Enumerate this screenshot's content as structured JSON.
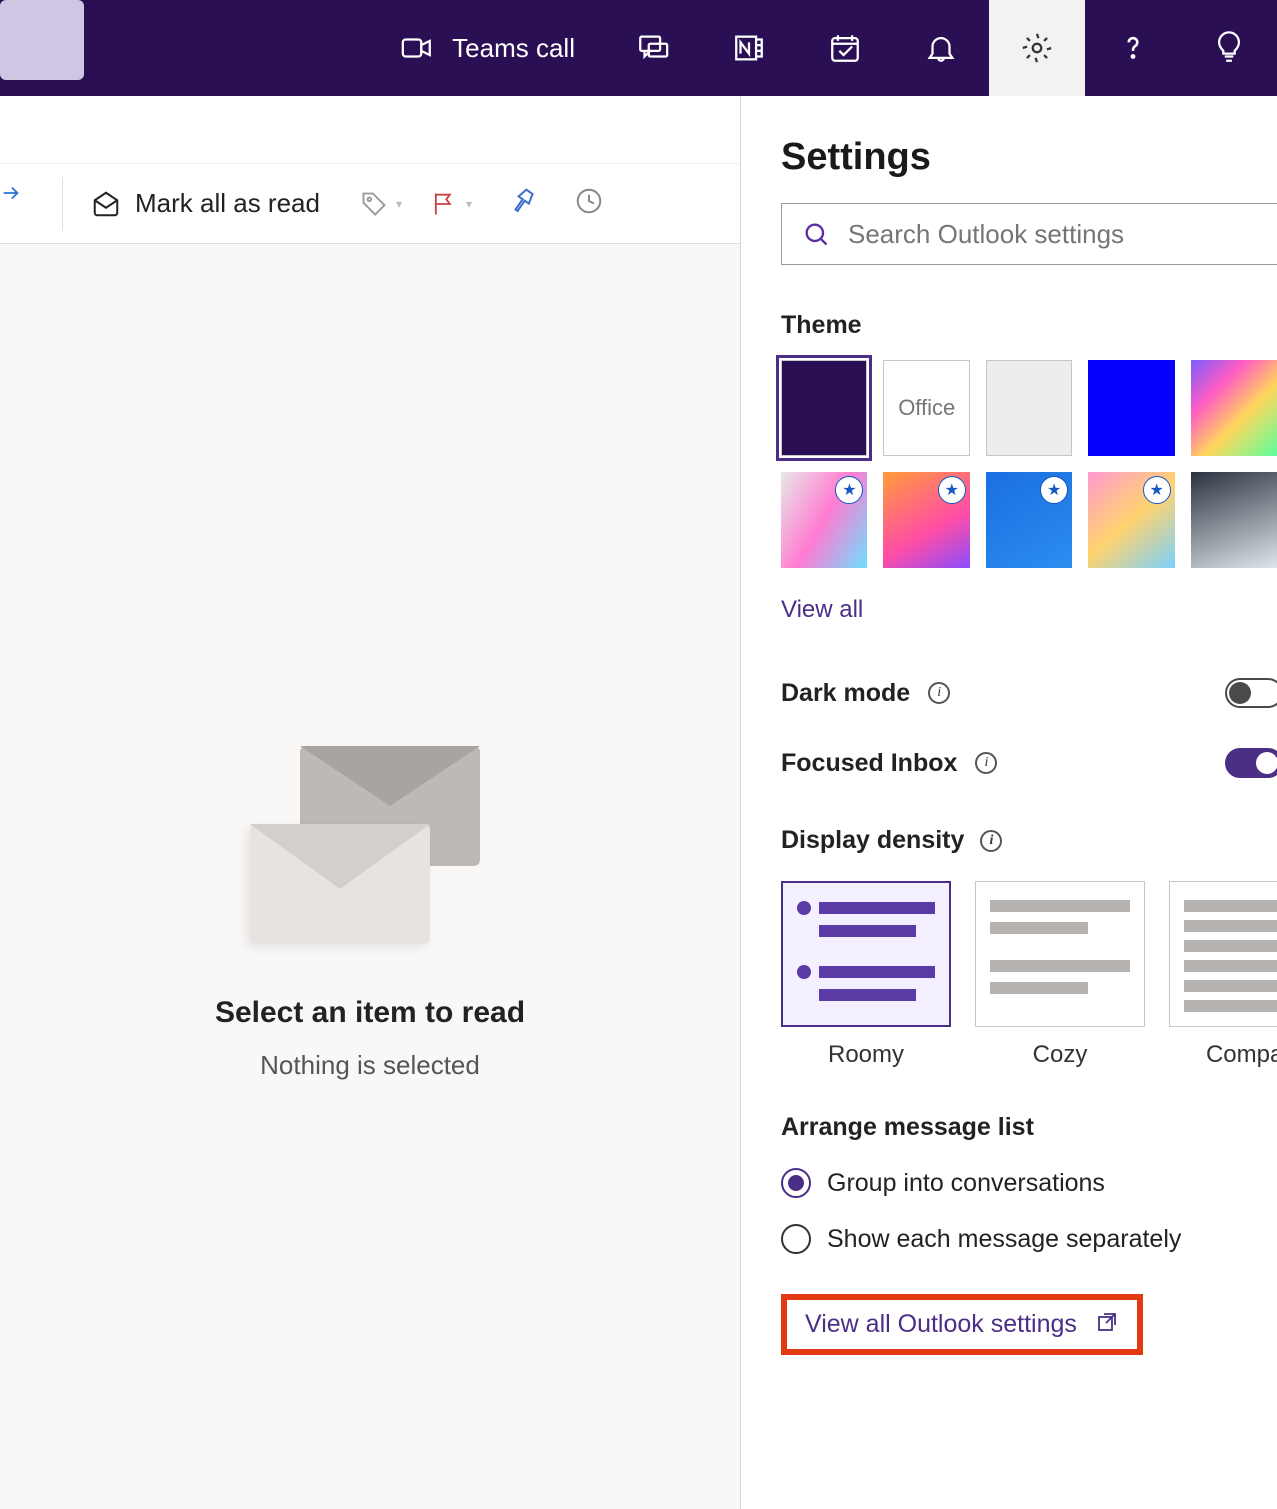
{
  "topbar": {
    "teams_call_label": "Teams call"
  },
  "toolbar": {
    "mark_all_read": "Mark all as read"
  },
  "reading_pane": {
    "title": "Select an item to read",
    "subtitle": "Nothing is selected"
  },
  "settings": {
    "title": "Settings",
    "search_placeholder": "Search Outlook settings",
    "theme_label": "Theme",
    "themes_row2_office": "Office",
    "view_all": "View all",
    "dark_mode_label": "Dark mode",
    "focused_inbox_label": "Focused Inbox",
    "display_density_label": "Display density",
    "density": {
      "roomy": "Roomy",
      "cozy": "Cozy",
      "compact": "Compact"
    },
    "arrange_label": "Arrange message list",
    "arrange_options": {
      "group": "Group into conversations",
      "separate": "Show each message separately"
    },
    "view_all_outlook": "View all Outlook settings"
  }
}
